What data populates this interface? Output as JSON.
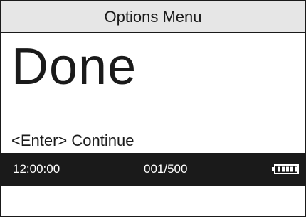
{
  "header": {
    "title": "Options Menu"
  },
  "main": {
    "message": "Done",
    "prompt": "<Enter> Continue"
  },
  "status_bar": {
    "time": "12:00:00",
    "count": "001/500",
    "battery_icon": "battery-full-icon",
    "battery_level": 1.0
  },
  "colors": {
    "text": "#1a1a1a",
    "header_bg": "#e6e6e6",
    "status_bg": "#1a1a1a",
    "status_text": "#ffffff"
  }
}
